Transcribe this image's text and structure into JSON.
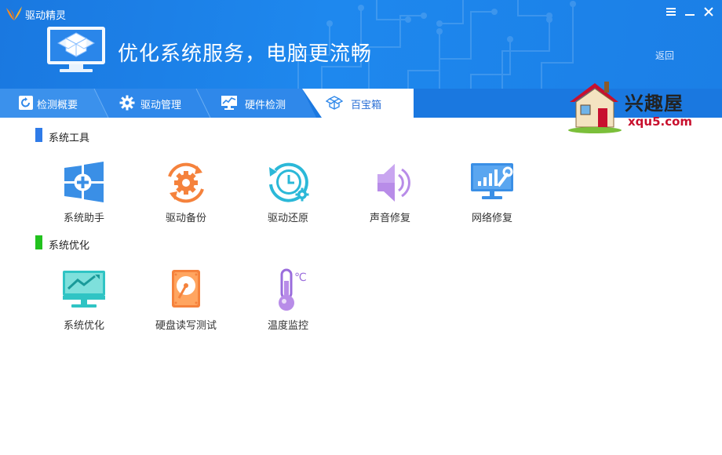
{
  "window": {
    "title": "驱动精灵"
  },
  "header": {
    "title": "优化系统服务，电脑更流畅",
    "back_label": "返回"
  },
  "tabs": [
    {
      "label": "检测概要",
      "icon": "refresh-icon"
    },
    {
      "label": "驱动管理",
      "icon": "gear-icon"
    },
    {
      "label": "硬件检测",
      "icon": "monitor-chart-icon"
    },
    {
      "label": "百宝箱",
      "icon": "toolbox-icon",
      "active": true
    }
  ],
  "watermark": {
    "title": "兴趣屋",
    "url": "xqu5.com"
  },
  "sections": [
    {
      "title": "系统工具",
      "color": "#2f7be8",
      "tools": [
        {
          "label": "系统助手",
          "icon": "windows-plus-icon"
        },
        {
          "label": "驱动备份",
          "icon": "gear-sync-icon"
        },
        {
          "label": "驱动还原",
          "icon": "clock-restore-icon"
        },
        {
          "label": "声音修复",
          "icon": "speaker-icon"
        },
        {
          "label": "网络修复",
          "icon": "network-repair-icon"
        }
      ]
    },
    {
      "title": "系统优化",
      "color": "#22c21e",
      "tools": [
        {
          "label": "系统优化",
          "icon": "monitor-trend-icon"
        },
        {
          "label": "硬盘读写测试",
          "icon": "hard-disk-icon"
        },
        {
          "label": "温度监控",
          "icon": "thermometer-icon"
        }
      ]
    }
  ]
}
